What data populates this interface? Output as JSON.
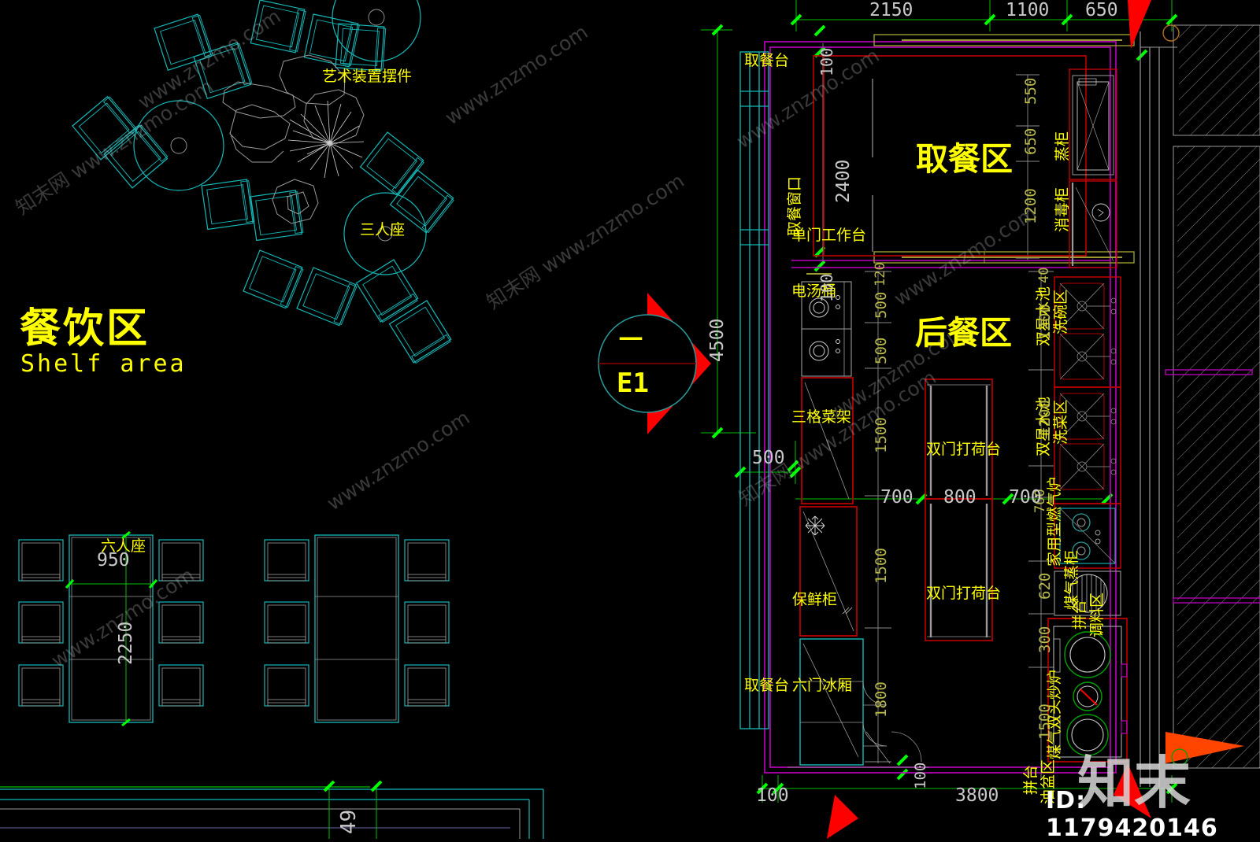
{
  "drawing": {
    "background": "#000000",
    "colors": {
      "label_yellow": "#ffff00",
      "dim_gray": "#c9c9c9",
      "dim_olive": "#b9b94a",
      "furniture_cyan": "#14b8b8",
      "equipment_red": "#c00000",
      "wall_magenta": "#c000c0",
      "dim_line_green": "#00c000",
      "tick_green": "#00ff00",
      "marker_red": "#ff0000",
      "gray_line": "#9a9a9a"
    }
  },
  "zones": {
    "dining": {
      "title_cn": "餐饮区",
      "title_en": "Shelf area"
    },
    "pickup_area": "取餐区",
    "back_kitchen": "后餐区"
  },
  "annotations": {
    "art_installation": "艺术装置摆件",
    "three_seat": "三人座",
    "six_seat": "六人座",
    "pickup_counter_top": "取餐台",
    "pickup_window": "取餐窗口",
    "single_door_worktable": "单门工作台",
    "electric_soup_bucket": "电汤桶",
    "three_grid_rack": "三格菜架",
    "fresh_keeping_cabinet": "保鲜柜",
    "pickup_counter_bottom": "取餐台",
    "six_door_freezer": "六门冰厢",
    "prep_counter_upper": "双门打荷台",
    "prep_counter_lower": "双门打荷台",
    "steam_cabinet": "蒸柜",
    "sterilizer_cabinet": "消毒柜",
    "dish_wash_sink": "双星水池\n洗碗区",
    "dish_wash_sink_line1": "双星水池",
    "dish_wash_sink_line2": "洗碗区",
    "veg_wash_sink_line1": "双星水池",
    "veg_wash_sink_line2": "洗菜区",
    "home_gas_stove": "家用型燃气炉",
    "gas_steam_cabinet": "煤气蒸柜",
    "seasoning_zone_line1": "拼台",
    "seasoning_zone_line2": "调料区",
    "gas_double_wok": "煤气双头炒炉",
    "oil_basin_zone_line1": "拼台",
    "oil_basin_zone_line2": "油盆区"
  },
  "section_marker": {
    "top_symbol": "一",
    "label": "E1"
  },
  "dimensions": {
    "top_chain": [
      "2150",
      "1100",
      "650"
    ],
    "left_vertical": "4500",
    "left_below": "500",
    "bottom_chain": [
      "100",
      "3800"
    ],
    "bottom_small": "100",
    "wall_top_left": "100",
    "wall_bot_left": "100",
    "inner_vertical_2400": "2400",
    "inner_left_chain": [
      "120",
      "500",
      "500",
      "1500",
      "1500",
      "1800"
    ],
    "inner_right_chain": [
      "40",
      "1200",
      "1200",
      "760",
      "620",
      "300",
      "1500"
    ],
    "right_upper_chain": [
      "550",
      "650",
      "1200"
    ],
    "mid_horizontal": [
      "700",
      "800",
      "700"
    ],
    "table_width": "950",
    "table_length": "2250",
    "bottom_left_partial": "49"
  },
  "watermark": {
    "logo": "知末",
    "id_text": "ID: 1179420146",
    "site_text": "知末网 www.znzmo.com",
    "site_text2": "www.znzmo.com"
  }
}
